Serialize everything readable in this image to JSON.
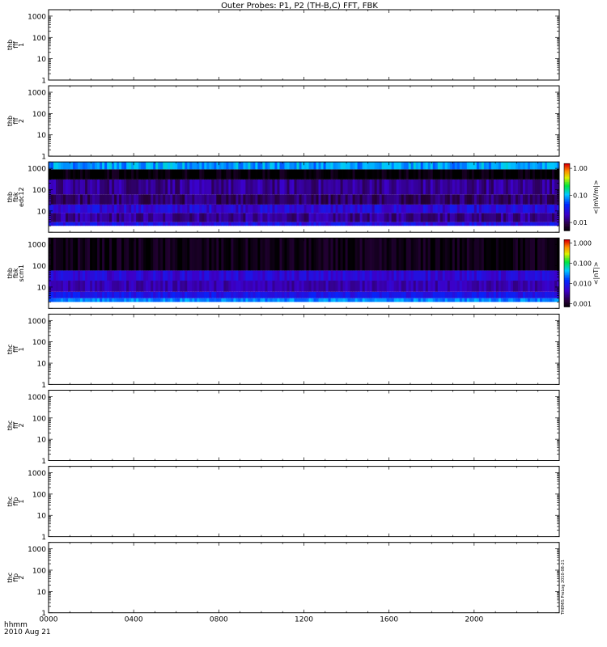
{
  "title": "Outer Probes: P1, P2 (TH-B,C) FFT, FBK",
  "panels": [
    {
      "label": [
        "thb",
        "fff",
        "1"
      ],
      "type": "empty",
      "y_ticks": [
        "1",
        "10",
        "100",
        "1000"
      ]
    },
    {
      "label": [
        "thb",
        "fff",
        "2"
      ],
      "type": "empty",
      "y_ticks": [
        "1",
        "10",
        "100",
        "1000"
      ]
    },
    {
      "label": [
        "thb",
        "fbk",
        "edc12"
      ],
      "type": "spectrogram",
      "y_ticks": [
        "10",
        "100",
        "1000"
      ],
      "colorbar": {
        "unit": "<|mV/m|>",
        "ticks": [
          "1.00",
          "0.10",
          "0.01"
        ]
      }
    },
    {
      "label": [
        "thb",
        "fbk",
        "scm1"
      ],
      "type": "spectrogram",
      "y_ticks": [
        "10",
        "100",
        "1000"
      ],
      "colorbar": {
        "unit": "<|nT|>",
        "ticks": [
          "1.000",
          "0.100",
          "0.010",
          "0.001"
        ]
      }
    },
    {
      "label": [
        "thc",
        "fff",
        "1"
      ],
      "type": "empty",
      "y_ticks": [
        "1",
        "10",
        "100",
        "1000"
      ]
    },
    {
      "label": [
        "thc",
        "fff",
        "2"
      ],
      "type": "empty",
      "y_ticks": [
        "1",
        "10",
        "100",
        "1000"
      ]
    },
    {
      "label": [
        "thc",
        "ffp",
        "1"
      ],
      "type": "empty",
      "y_ticks": [
        "1",
        "10",
        "100",
        "1000"
      ]
    },
    {
      "label": [
        "thc",
        "ffp",
        "2"
      ],
      "type": "empty",
      "y_ticks": [
        "1",
        "10",
        "100",
        "1000"
      ]
    }
  ],
  "x_axis": {
    "label": "hhmm",
    "date": "2010 Aug 21",
    "ticks": [
      "0000",
      "0400",
      "0800",
      "1200",
      "1600",
      "2000"
    ]
  },
  "chart_data": {
    "type": "heatmap",
    "title": "Outer Probes: P1, P2 (TH-B,C) FFT, FBK",
    "x_ticks": [
      "0000",
      "0400",
      "0800",
      "1200",
      "1600",
      "2000"
    ],
    "x_range_hours": [
      0,
      24
    ],
    "y_scale": "log",
    "y_range": [
      1,
      2000
    ],
    "series": [
      {
        "name": "thb fbk edc12",
        "unit": "<|mV/m|>",
        "color_range": [
          0.005,
          1.5
        ],
        "band_levels": [
          {
            "f_range": [
              2,
              3
            ],
            "value": 0.03
          },
          {
            "f_range": [
              3,
              8
            ],
            "value": 0.015
          },
          {
            "f_range": [
              8,
              20
            ],
            "value": 0.025
          },
          {
            "f_range": [
              20,
              60
            ],
            "value": 0.012
          },
          {
            "f_range": [
              60,
              300
            ],
            "value": 0.015
          },
          {
            "f_range": [
              300,
              900
            ],
            "value": 0.005
          },
          {
            "f_range": [
              900,
              2000
            ],
            "value": 0.09
          }
        ]
      },
      {
        "name": "thb fbk scm1",
        "unit": "<|nT|>",
        "color_range": [
          0.0007,
          1.5
        ],
        "band_levels": [
          {
            "f_range": [
              2,
              3
            ],
            "value": 0.03
          },
          {
            "f_range": [
              3,
              6
            ],
            "value": 0.009
          },
          {
            "f_range": [
              6,
              20
            ],
            "value": 0.004
          },
          {
            "f_range": [
              20,
              60
            ],
            "value": 0.006
          },
          {
            "f_range": [
              60,
              2000
            ],
            "value": 0.0009
          }
        ]
      }
    ]
  },
  "side_stamp": "THEMIS ProLog 2010-08-21"
}
